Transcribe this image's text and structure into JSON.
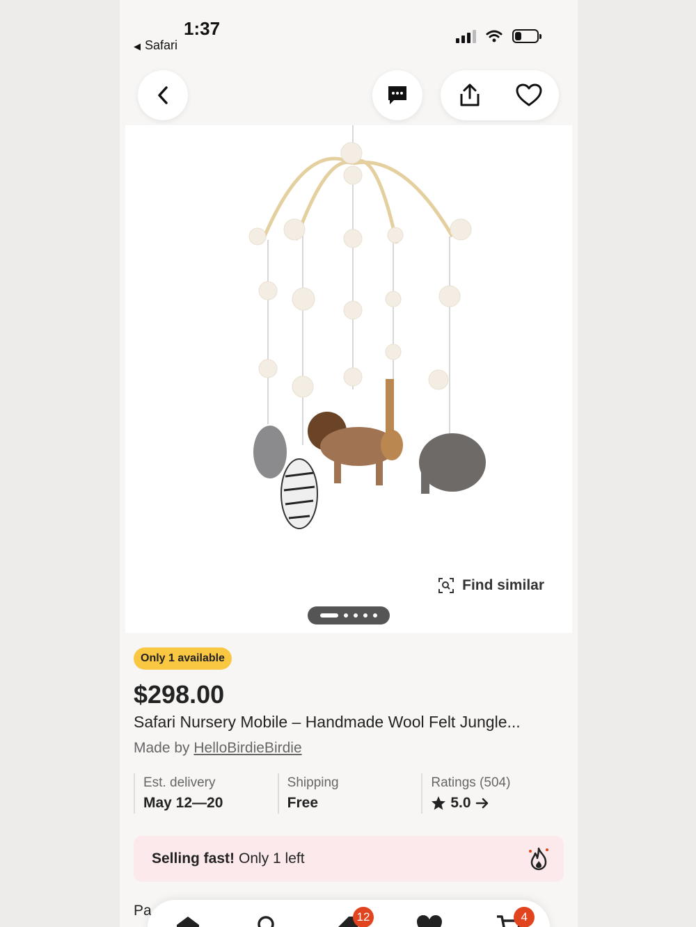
{
  "status_bar": {
    "time": "1:37",
    "back_app": "Safari"
  },
  "product": {
    "availability_badge": "Only 1 available",
    "price": "$298.00",
    "title": "Safari Nursery Mobile – Handmade Wool Felt Jungle...",
    "made_by_prefix": "Made by ",
    "shop_name": "HelloBirdieBirdie",
    "find_similar": "Find similar",
    "image_index": 1,
    "image_count": 5
  },
  "stats": {
    "delivery_label": "Est. delivery",
    "delivery_value": "May 12—20",
    "shipping_label": "Shipping",
    "shipping_value": "Free",
    "ratings_label": "Ratings (504)",
    "ratings_value": "5.0"
  },
  "selling_fast": {
    "strong": "Selling fast!",
    "text": "Only 1 left"
  },
  "partial_text": "Pa",
  "tab_bar": {
    "favorites_count": "12",
    "cart_count": "4"
  },
  "colors": {
    "badge": "#f9c742",
    "alert_bg": "#fbe9ec",
    "notification": "#e0451f"
  }
}
